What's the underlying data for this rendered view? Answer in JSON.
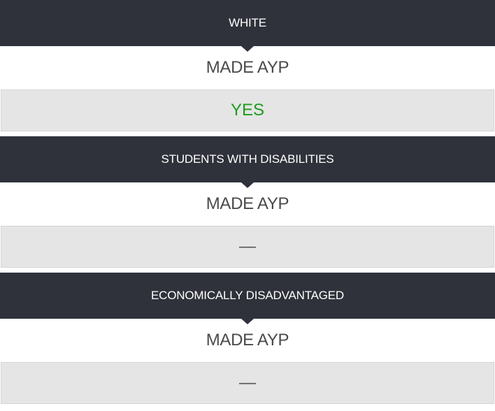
{
  "groups": [
    {
      "header": "WHITE",
      "metric": "MADE AYP",
      "value": "YES",
      "value_color": "#1f9a1f"
    },
    {
      "header": "STUDENTS WITH DISABILITIES",
      "metric": "MADE AYP",
      "value": "—",
      "value_color": "#555555"
    },
    {
      "header": "ECONOMICALLY DISADVANTAGED",
      "metric": "MADE AYP",
      "value": "—",
      "value_color": "#555555"
    }
  ]
}
